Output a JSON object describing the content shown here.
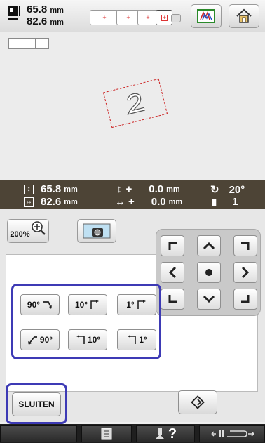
{
  "header": {
    "height_value": "65.8",
    "width_value": "82.6",
    "unit": "mm"
  },
  "infobar": {
    "height_value": "65.8",
    "width_value": "82.6",
    "unit": "mm",
    "v_offset_sign": "+",
    "v_offset_value": "0.0",
    "h_offset_sign": "+",
    "h_offset_value": "0.0",
    "angle": "20°",
    "color_count": "1"
  },
  "toolbar": {
    "zoom_label": "200%"
  },
  "rotate": {
    "cw90": "90°",
    "cw10": "10°",
    "cw1": "1°",
    "ccw90": "90°",
    "ccw10": "10°",
    "ccw1": "1°"
  },
  "actions": {
    "close_label": "SLUITEN"
  },
  "bottom": {
    "help_label": "?"
  },
  "colors": {
    "highlight": "#3d3ab5",
    "infobar_bg": "#4d4436",
    "pattern_outline": "#cc2222"
  }
}
